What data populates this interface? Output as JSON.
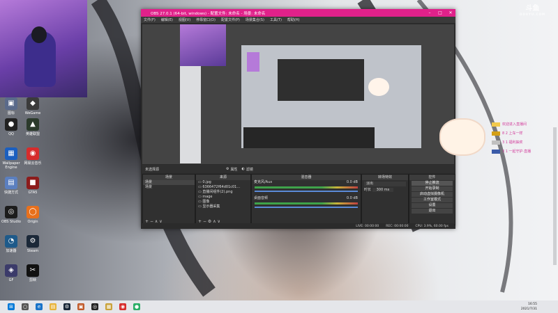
{
  "watermark": {
    "logo": "斗鱼",
    "sub": "DOUYU.COM"
  },
  "desktop_icons": [
    {
      "name": "desktop-icon-1",
      "label": "图标",
      "icon": "game-icon",
      "color": "#5a6a8a",
      "glyph": "▣"
    },
    {
      "name": "desktop-icon-2",
      "label": "WeGame",
      "icon": "wegame-icon",
      "color": "#3b3b3b",
      "glyph": "◆"
    },
    {
      "name": "desktop-icon-qq",
      "label": "QQ",
      "icon": "qq-icon",
      "color": "#222",
      "glyph": "●"
    },
    {
      "name": "desktop-icon-3",
      "label": "英雄联盟",
      "icon": "lol-icon",
      "color": "#2b3a2b",
      "glyph": "▲"
    },
    {
      "name": "desktop-icon-4",
      "label": "Wallpaper Engine",
      "icon": "wallpaper-icon",
      "color": "#1b5fbf",
      "glyph": "▦"
    },
    {
      "name": "desktop-icon-5",
      "label": "网易云音乐",
      "icon": "netease-icon",
      "color": "#d62c2c",
      "glyph": "◉"
    },
    {
      "name": "desktop-icon-6",
      "label": "快捷方式",
      "icon": "shortcut-icon",
      "color": "#5b7fbf",
      "glyph": "▤"
    },
    {
      "name": "desktop-icon-7",
      "label": "GTA5",
      "icon": "game-icon",
      "color": "#8c1c1c",
      "glyph": "■"
    },
    {
      "name": "desktop-icon-obs",
      "label": "OBS Studio",
      "icon": "obs-icon",
      "color": "#1c1c1c",
      "glyph": "◎"
    },
    {
      "name": "desktop-icon-origin",
      "label": "Origin",
      "icon": "origin-icon",
      "color": "#e8701c",
      "glyph": "◯"
    },
    {
      "name": "desktop-icon-8",
      "label": "加速器",
      "icon": "accelerator-icon",
      "color": "#1e5a8a",
      "glyph": "◔"
    },
    {
      "name": "desktop-icon-steam",
      "label": "Steam",
      "icon": "steam-icon",
      "color": "#1b2838",
      "glyph": "⚙"
    },
    {
      "name": "desktop-icon-9",
      "label": "GF",
      "icon": "gf-icon",
      "color": "#3b3b6a",
      "glyph": "◈"
    },
    {
      "name": "desktop-icon-capcut",
      "label": "剪映",
      "icon": "capcut-icon",
      "color": "#111",
      "glyph": "✂"
    }
  ],
  "obs": {
    "title": "OBS 27.0.1 (64-bit, windows) - 配置文件: 未命名 - 场景: 未命名",
    "menu": [
      "文件(F)",
      "编辑(E)",
      "视图(V)",
      "停靠窗口(D)",
      "配置文件(P)",
      "场景集合(S)",
      "工具(T)",
      "帮助(H)"
    ],
    "scene_bar": {
      "label": "未选择源",
      "props": "属性",
      "filters": "滤镜"
    },
    "scenes": {
      "title": "场景",
      "items": [
        "场景",
        "场景"
      ]
    },
    "sources": {
      "title": "来源",
      "items": [
        "0.jpg",
        "6366472f64d01c01...",
        "直播间组件(2).png",
        "mage",
        "图像",
        "显示器采集"
      ]
    },
    "mixer": {
      "title": "混音器",
      "tracks": [
        {
          "name": "麦克风/Aux",
          "db": "0.0 dB"
        },
        {
          "name": "桌面音频",
          "db": "0.0 dB"
        }
      ]
    },
    "transitions": {
      "title": "转场特效",
      "type": "淡出",
      "duration_label": "时长",
      "duration": "300 ms"
    },
    "controls": {
      "title": "控件",
      "buttons": [
        "停止推流",
        "开始录制",
        "启动虚拟摄像机",
        "工作室模式",
        "设置",
        "退出"
      ]
    },
    "status": {
      "live": "LIVE: 00:00:00",
      "rec": "REC: 00:00:00",
      "cpu": "CPU: 3.9%, 60.00 fps"
    }
  },
  "chat": [
    {
      "text": "欢迎进入直播间",
      "badge": "#f2c94c"
    },
    {
      "text": "8 2 上车一样",
      "badge": "#d4a017"
    },
    {
      "text": "3 1 福利抽奖",
      "badge": "#c0c0c0"
    },
    {
      "text": "3 1 一起守护·直播",
      "badge": "#3b5ba8"
    }
  ],
  "taskbar": {
    "time": "16:55",
    "date": "2021/7/31",
    "apps": [
      {
        "name": "start-icon",
        "glyph": "⊞",
        "color": "#0078d7"
      },
      {
        "name": "search-icon",
        "glyph": "○",
        "color": "#555"
      },
      {
        "name": "edge-icon",
        "glyph": "e",
        "color": "#1a73c9"
      },
      {
        "name": "file-explorer-icon",
        "glyph": "▤",
        "color": "#e8b33a"
      },
      {
        "name": "steam-icon",
        "glyph": "⚙",
        "color": "#1b2838"
      },
      {
        "name": "game-icon",
        "glyph": "▣",
        "color": "#c05a2a"
      },
      {
        "name": "obs-icon",
        "glyph": "◎",
        "color": "#222"
      },
      {
        "name": "app-icon",
        "glyph": "▦",
        "color": "#c9a23a"
      },
      {
        "name": "netease-icon",
        "glyph": "◉",
        "color": "#d62c2c"
      },
      {
        "name": "wechat-icon",
        "glyph": "●",
        "color": "#2aae67"
      }
    ]
  }
}
